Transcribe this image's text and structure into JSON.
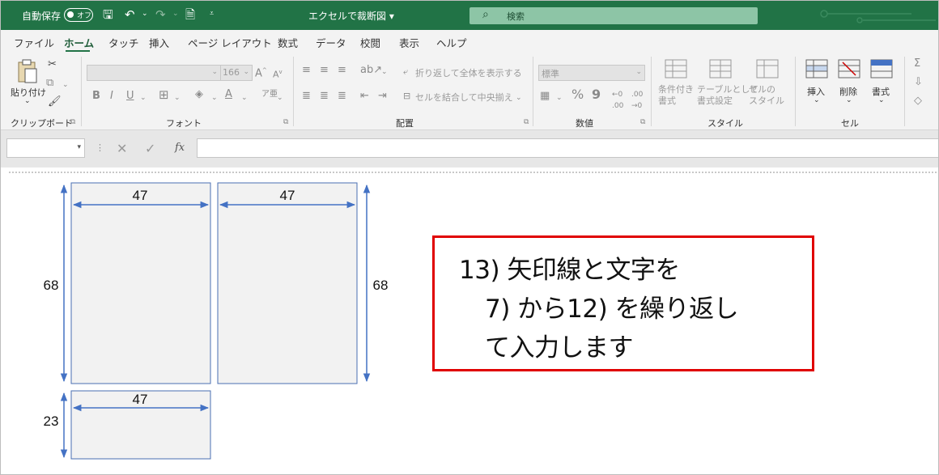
{
  "titlebar": {
    "autosave_label": "自動保存",
    "autosave_state": "オフ",
    "doc_title": "エクセルで裁断図",
    "search_placeholder": "検索"
  },
  "tabs": [
    "ファイル",
    "ホーム",
    "タッチ",
    "挿入",
    "ページ レイアウト",
    "数式",
    "データ",
    "校閲",
    "表示",
    "ヘルプ"
  ],
  "active_tab": "ホーム",
  "ribbon": {
    "clipboard": {
      "paste": "貼り付け",
      "label": "クリップボード"
    },
    "font": {
      "size": "166",
      "bold": "B",
      "italic": "I",
      "underline": "U",
      "label": "フォント"
    },
    "alignment": {
      "wrap": "折り返して全体を表示する",
      "merge": "セルを結合して中央揃え",
      "label": "配置"
    },
    "number": {
      "format": "標準",
      "percent": "%",
      "comma": "9",
      "label": "数値"
    },
    "styles": {
      "conditional": "条件付き\n書式",
      "table": "テーブルとして\n書式設定",
      "cell": "セルの\nスタイル",
      "label": "スタイル"
    },
    "cells": {
      "insert": "挿入",
      "delete": "削除",
      "format": "書式",
      "label": "セル"
    }
  },
  "formula_bar": {
    "fx": "fx"
  },
  "sheet": {
    "panels": [
      {
        "width_label": "47",
        "height_label": "68"
      },
      {
        "width_label": "47",
        "height_label": "68"
      },
      {
        "width_label": "47",
        "height_label": "23"
      }
    ],
    "callout": {
      "line1": "13) 矢印線と文字を",
      "line2": "7) から12) を繰り返し",
      "line3": "て入力します"
    }
  },
  "colors": {
    "excel_green": "#217346",
    "callout_border": "#e00000",
    "arrow_blue": "#4472c4",
    "panel_fill": "#f2f2f2"
  }
}
